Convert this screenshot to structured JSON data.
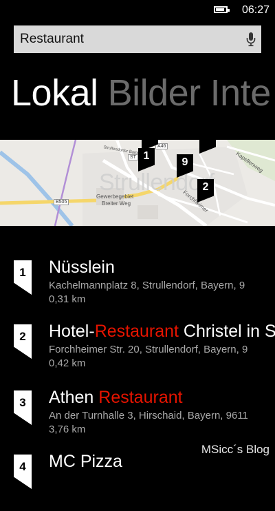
{
  "status": {
    "time": "06:27",
    "battery_level": 0.85
  },
  "search": {
    "query": "Restaurant"
  },
  "pivot": {
    "tabs": [
      "Lokal",
      "Bilder",
      "Inte"
    ],
    "active_index": 0
  },
  "map": {
    "town": "Strullendorf",
    "labels": {
      "gewerbe_1": "Gewerbegebiet",
      "gewerbe_2": "Breiter Weg",
      "kapellen": "Kapellenweg",
      "forchheimer": "Forchheimer",
      "bamberger": "Strullendorfer Bamberger"
    },
    "road_badges": {
      "b505": "B505",
      "a46": "A46",
      "st": "ST"
    },
    "pins": [
      "1",
      "9",
      "2"
    ]
  },
  "results": [
    {
      "number": "1",
      "name_prefix": "Nüsslein",
      "name_highlight": "",
      "name_suffix": "",
      "address": "Kachelmannplatz 8, Strullendorf, Bayern, 9",
      "distance": "0,31 km"
    },
    {
      "number": "2",
      "name_prefix": "Hotel-",
      "name_highlight": "Restaurant",
      "name_suffix": " Christel in S",
      "address": "Forchheimer Str. 20, Strullendorf, Bayern, 9",
      "distance": "0,42 km"
    },
    {
      "number": "3",
      "name_prefix": "Athen ",
      "name_highlight": "Restaurant",
      "name_suffix": "",
      "address": "An der Turnhalle 3, Hirschaid, Bayern, 9611",
      "distance": "3,76 km"
    },
    {
      "number": "4",
      "name_prefix": "MC Pizza",
      "name_highlight": "",
      "name_suffix": "",
      "address": "",
      "distance": ""
    }
  ],
  "watermark": "MSicc´s Blog",
  "colors": {
    "accent": "#e51400",
    "background": "#000000",
    "search_box": "#d9d9d9"
  }
}
